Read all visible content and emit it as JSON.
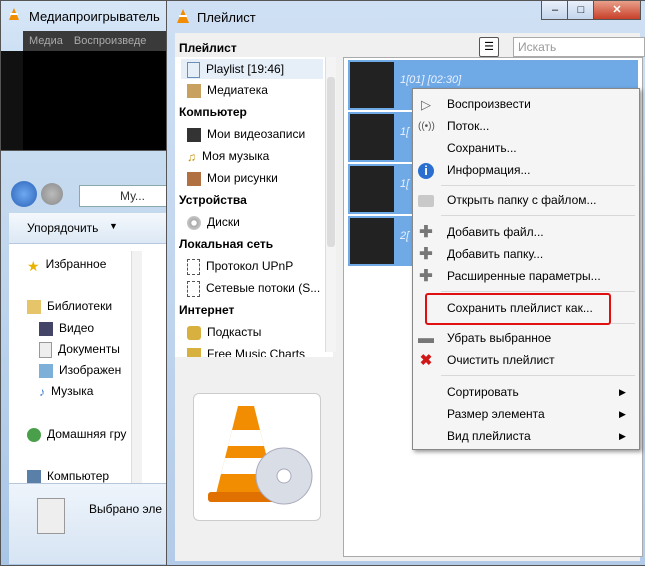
{
  "back_window": {
    "title": "Медиапроигрыватель",
    "menu": [
      "Медиа",
      "Воспроизведе"
    ]
  },
  "explorer": {
    "address": "Му...",
    "organize": "Упорядочить",
    "items": [
      {
        "label": "Избранное",
        "icon": "star-icon"
      },
      {
        "label": "Библиотеки",
        "icon": "library-icon"
      },
      {
        "label": "Видео",
        "icon": "video-icon"
      },
      {
        "label": "Документы",
        "icon": "document-icon"
      },
      {
        "label": "Изображен",
        "icon": "image-icon"
      },
      {
        "label": "Музыка",
        "icon": "music-icon"
      },
      {
        "label": "Домашняя гру",
        "icon": "homegroup-icon"
      },
      {
        "label": "Компьютер",
        "icon": "computer-icon"
      }
    ],
    "status": "Выбрано эле"
  },
  "playlist_window": {
    "title": "Плейлист",
    "search_placeholder": "Искать",
    "tree": {
      "header_playlist": "Плейлист",
      "playlist_item": "Playlist [19:46]",
      "media_library": "Медиатека",
      "header_computer": "Компьютер",
      "computer_items": [
        "Мои видеозаписи",
        "Моя музыка",
        "Мои рисунки"
      ],
      "header_devices": "Устройства",
      "devices_items": [
        "Диски"
      ],
      "header_lan": "Локальная сеть",
      "lan_items": [
        "Протокол UPnP",
        "Сетевые потоки (S..."
      ],
      "header_internet": "Интернет",
      "internet_items": [
        "Подкасты",
        "Free Music Charts"
      ]
    },
    "tracks": [
      "1[01] [02:30]",
      "1[",
      "1[",
      "2["
    ]
  },
  "context_menu": {
    "items": [
      {
        "label": "Воспроизвести",
        "icon": "play-icon"
      },
      {
        "label": "Поток...",
        "icon": "stream-icon"
      },
      {
        "label": "Сохранить...",
        "icon": ""
      },
      {
        "label": "Информация...",
        "icon": "info-icon"
      },
      {
        "label": "Открыть папку с файлом...",
        "icon": "folder-icon"
      },
      {
        "label": "Добавить файл...",
        "icon": "plus-icon"
      },
      {
        "label": "Добавить папку...",
        "icon": "plus-icon"
      },
      {
        "label": "Расширенные параметры...",
        "icon": "plus-icon"
      },
      {
        "label": "Сохранить плейлист как...",
        "icon": ""
      },
      {
        "label": "Убрать выбранное",
        "icon": "minus-icon"
      },
      {
        "label": "Очистить плейлист",
        "icon": "red-x-icon"
      },
      {
        "label": "Сортировать",
        "icon": ""
      },
      {
        "label": "Размер элемента",
        "icon": ""
      },
      {
        "label": "Вид плейлиста",
        "icon": ""
      }
    ]
  },
  "colors": {
    "highlight": "#e01010",
    "selection": "#6fa9e6",
    "vlc_orange": "#f28c00"
  }
}
